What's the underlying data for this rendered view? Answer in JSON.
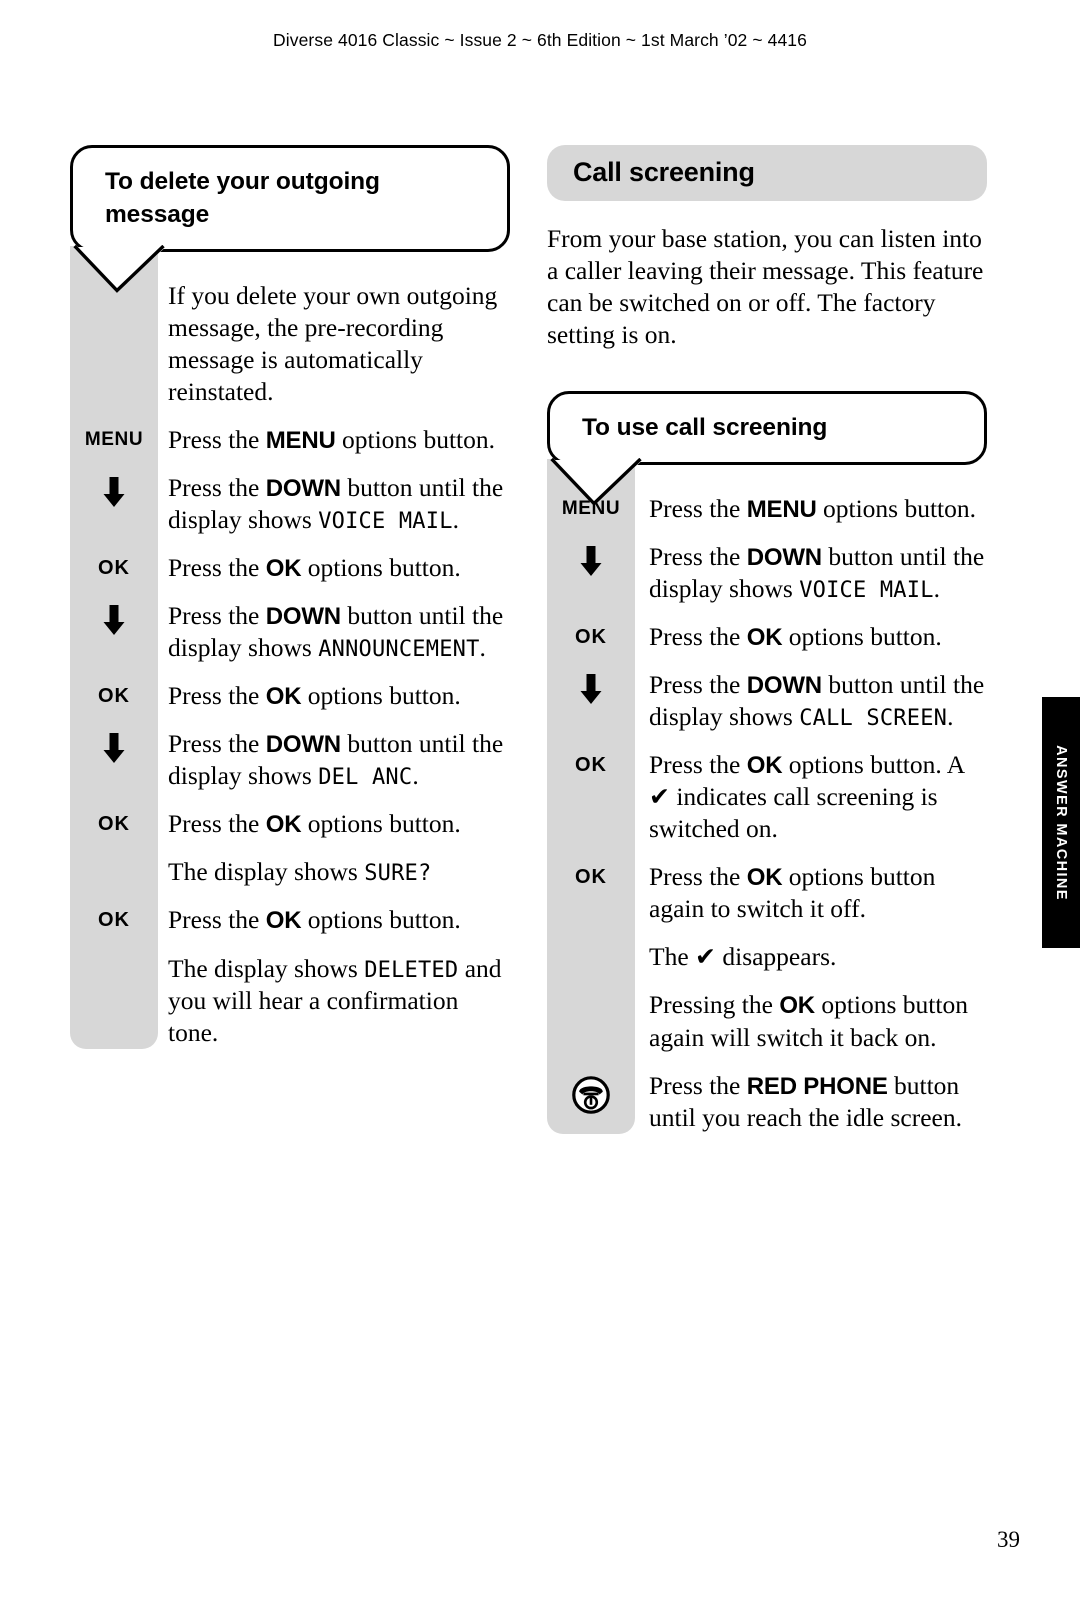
{
  "running_head": "Diverse 4016 Classic ~ Issue 2 ~ 6th Edition ~ 1st March ’02 ~ 4416",
  "page_number": "39",
  "thumb_tab": {
    "label": "ANSWER MACHINE"
  },
  "colors": {
    "grey_band": "#d7d7d7",
    "banner": "#d7d7d7",
    "tab": "#000000",
    "text": "#000000"
  },
  "left_column": {
    "heading": "To delete your outgoing message",
    "steps": [
      {
        "key": "",
        "key_icon": "",
        "text_html": "If you delete your own outgoing message, the pre-recording message is automatically reinstated."
      },
      {
        "key": "MENU",
        "key_icon": "",
        "text_html": "Press the <b class=\"btn\">MENU</b> options button."
      },
      {
        "key": "",
        "key_icon": "arrow-down-icon",
        "text_html": "Press the <b class=\"btn\">DOWN</b> button until the display shows <span class=\"lcd\">VOICE MAIL</span>."
      },
      {
        "key": "OK",
        "key_icon": "",
        "text_html": "Press the <b class=\"btn\">OK</b> options button."
      },
      {
        "key": "",
        "key_icon": "arrow-down-icon",
        "text_html": "Press the <b class=\"btn\">DOWN</b> button until the display shows <span class=\"lcd\">ANNOUNCEMENT</span>."
      },
      {
        "key": "OK",
        "key_icon": "",
        "text_html": "Press the <b class=\"btn\">OK</b> options button."
      },
      {
        "key": "",
        "key_icon": "arrow-down-icon",
        "text_html": "Press the <b class=\"btn\">DOWN</b> button until the display shows <span class=\"lcd\">DEL ANC</span>."
      },
      {
        "key": "OK",
        "key_icon": "",
        "text_html": "Press the <b class=\"btn\">OK</b> options button."
      },
      {
        "key": "",
        "key_icon": "",
        "text_html": "The display shows <span class=\"lcd\">SURE?</span>"
      },
      {
        "key": "OK",
        "key_icon": "",
        "text_html": "Press the <b class=\"btn\">OK</b> options button."
      },
      {
        "key": "",
        "key_icon": "",
        "text_html": "The display shows <span class=\"lcd\">DELETED</span> and you will hear a confirmation tone."
      }
    ]
  },
  "right_column": {
    "section_title": "Call screening",
    "intro": "From your base station, you can listen into a caller leaving their message. This feature can be switched on or off. The factory setting is on.",
    "heading": "To use call screening",
    "steps": [
      {
        "key": "MENU",
        "key_icon": "",
        "text_html": "Press the <b class=\"btn\">MENU</b> options button."
      },
      {
        "key": "",
        "key_icon": "arrow-down-icon",
        "text_html": "Press the <b class=\"btn\">DOWN</b> button until the display shows <span class=\"lcd\">VOICE MAIL</span>."
      },
      {
        "key": "OK",
        "key_icon": "",
        "text_html": "Press the <b class=\"btn\">OK</b> options button."
      },
      {
        "key": "",
        "key_icon": "arrow-down-icon",
        "text_html": "Press the <b class=\"btn\">DOWN</b> button until the display shows <span class=\"lcd\">CALL SCREEN</span>."
      },
      {
        "key": "OK",
        "key_icon": "",
        "text_html": "Press the <b class=\"btn\">OK</b> options button. A <span class=\"tick\">&#10004;</span> indicates call screening is switched on."
      },
      {
        "key": "OK",
        "key_icon": "",
        "text_html": "Press the <b class=\"btn\">OK</b> options button again to switch it off."
      },
      {
        "key": "",
        "key_icon": "",
        "text_html": "The <span class=\"tick\">&#10004;</span> disappears."
      },
      {
        "key": "",
        "key_icon": "",
        "text_html": "Pressing the <b class=\"btn\">OK</b> options button again will switch it back on."
      },
      {
        "key": "",
        "key_icon": "red-phone-icon",
        "text_html": "Press the <b class=\"btn\">RED PHONE</b> button until you reach the idle screen."
      }
    ]
  }
}
